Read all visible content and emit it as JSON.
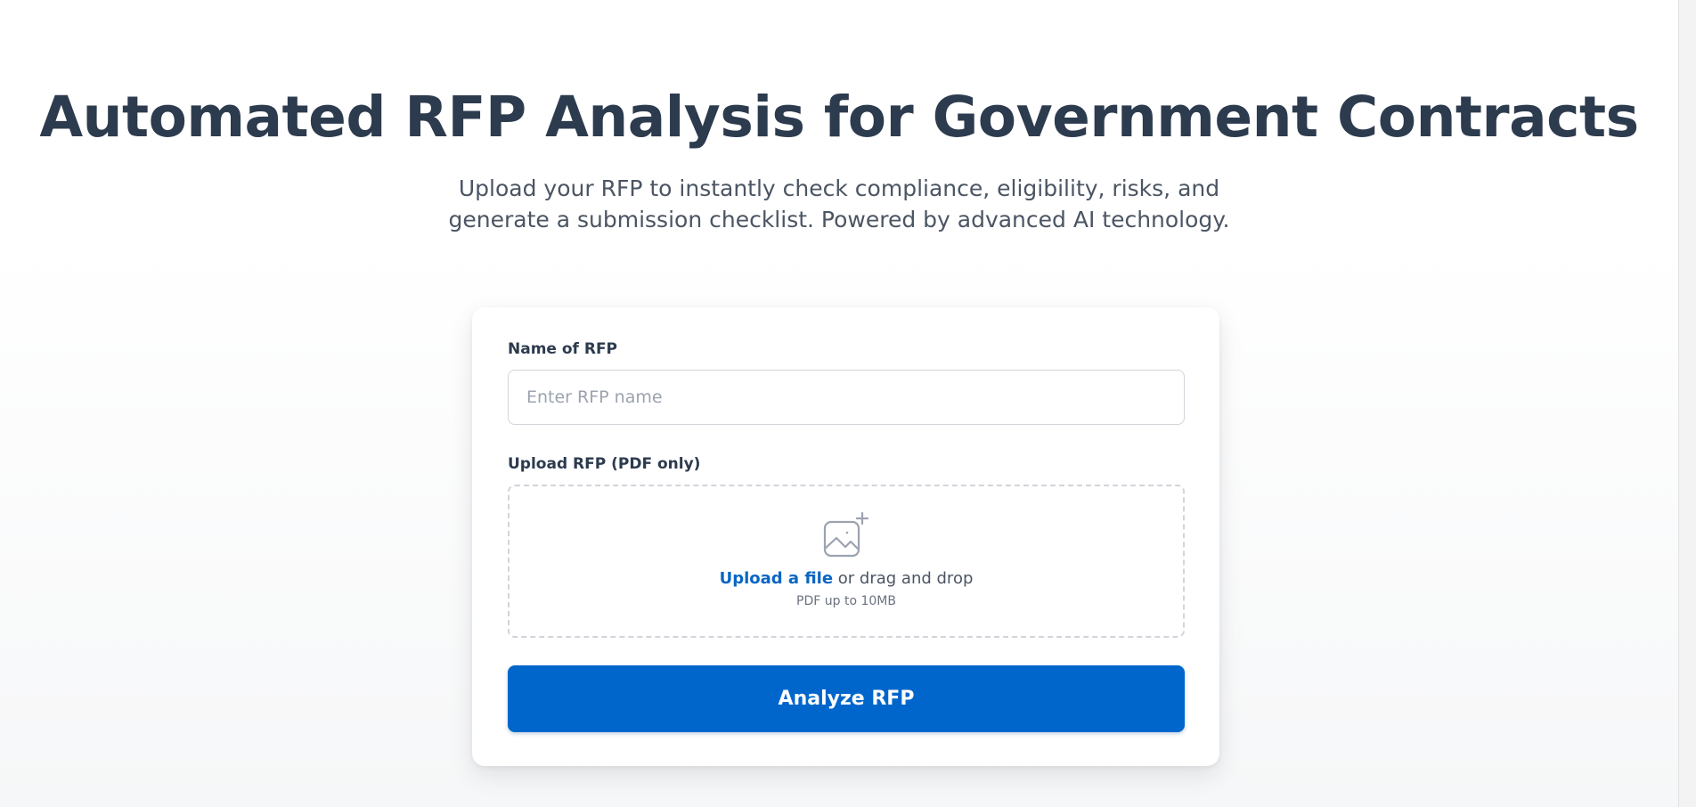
{
  "hero": {
    "title": "Automated RFP Analysis for Government Contracts",
    "subtitle": "Upload your RFP to instantly check compliance, eligibility, risks, and generate a submission checklist. Powered by advanced AI technology."
  },
  "form": {
    "name_label": "Name of RFP",
    "name_placeholder": "Enter RFP name",
    "name_value": "",
    "upload_label": "Upload RFP (PDF only)",
    "upload_link": "Upload a file",
    "upload_text": " or drag and drop",
    "upload_hint": "PDF up to 10MB",
    "upload_icon": "image-add-icon",
    "submit_label": "Analyze RFP"
  },
  "colors": {
    "accent": "#0066cc",
    "heading": "#2d3b4e",
    "muted": "#4b5563"
  }
}
